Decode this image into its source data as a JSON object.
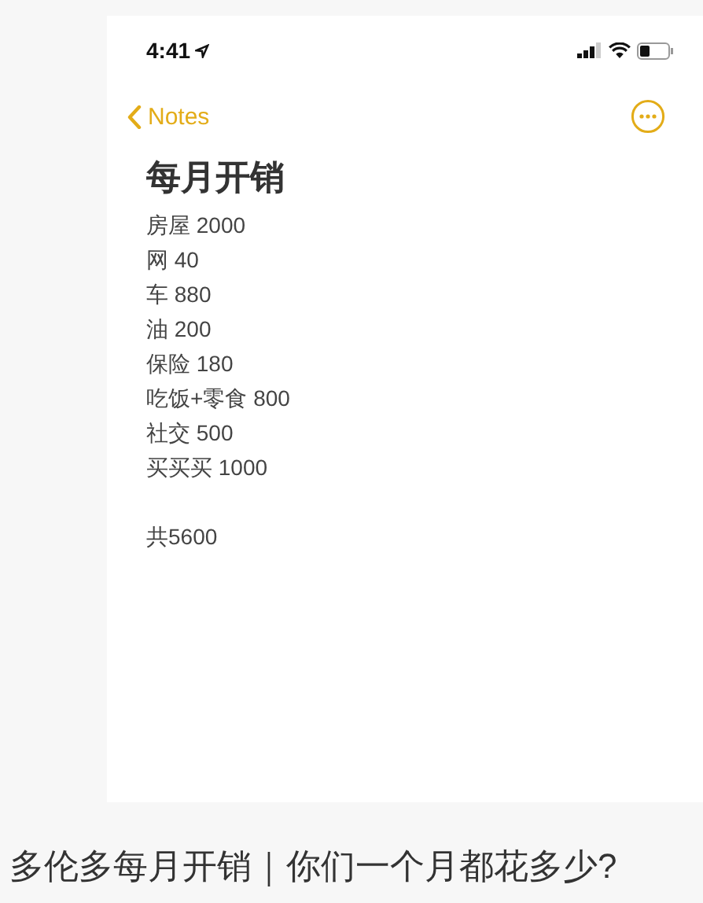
{
  "status_bar": {
    "time": "4:41"
  },
  "nav": {
    "back": "Notes"
  },
  "note": {
    "title": "每月开销",
    "lines": [
      "房屋 2000",
      "网 40",
      "车 880",
      "油 200",
      "保险 180",
      "吃饭+零食 800",
      "社交 500",
      "买买买 1000"
    ],
    "total": "共5600"
  },
  "caption": "多伦多每月开销｜你们一个月都花多少?"
}
